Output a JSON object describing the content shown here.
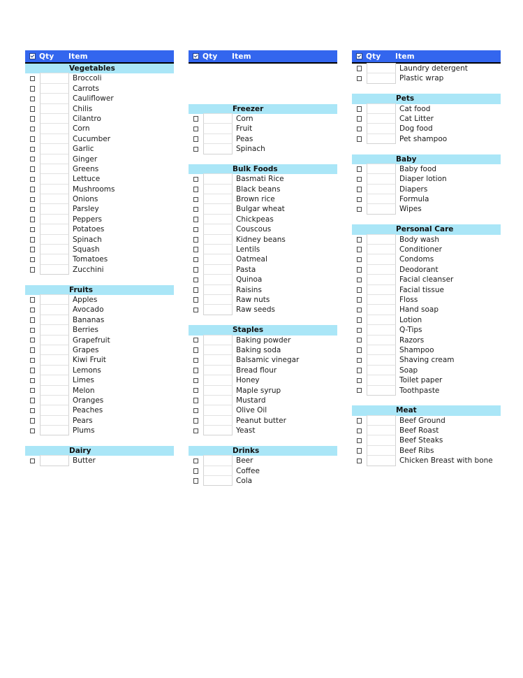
{
  "colors": {
    "header_bar": "#3366ee",
    "header_text": "#ffffff",
    "section_header": "#aae6f7",
    "qty_cell_border": "#d2d2d2",
    "checkbox_border": "#4a4a4a",
    "page_background": "#ffffff"
  },
  "header": {
    "check_icon": "checked-box-icon",
    "qty_label": "Qty",
    "item_label": "Item"
  },
  "columns": [
    {
      "name": "left-column",
      "blocks": [
        {
          "type": "section",
          "title": "Vegetables",
          "items": [
            "Broccoli",
            "Carrots",
            "Cauliflower",
            "Chilis",
            "Cilantro",
            "Corn",
            "Cucumber",
            "Garlic",
            "Ginger",
            "Greens",
            "Lettuce",
            "Mushrooms",
            "Onions",
            "Parsley",
            "Peppers",
            "Potatoes",
            "Spinach",
            "Squash",
            "Tomatoes",
            "Zucchini"
          ]
        },
        {
          "type": "spacer"
        },
        {
          "type": "section",
          "title": "Fruits",
          "items": [
            "Apples",
            "Avocado",
            "Bananas",
            "Berries",
            "Grapefruit",
            "Grapes",
            "Kiwi Fruit",
            "Lemons",
            "Limes",
            "Melon",
            "Oranges",
            "Peaches",
            "Pears",
            "Plums"
          ]
        },
        {
          "type": "spacer"
        },
        {
          "type": "section",
          "title": "Dairy",
          "items": [
            "Butter"
          ]
        }
      ]
    },
    {
      "name": "middle-column",
      "blocks": [
        {
          "type": "spacer"
        },
        {
          "type": "spacer"
        },
        {
          "type": "spacer"
        },
        {
          "type": "spacer"
        },
        {
          "type": "section",
          "title": "Freezer",
          "items": [
            "Corn",
            "Fruit",
            "Peas",
            "Spinach"
          ]
        },
        {
          "type": "spacer"
        },
        {
          "type": "section",
          "title": "Bulk Foods",
          "items": [
            "Basmati Rice",
            "Black beans",
            "Brown rice",
            "Bulgar wheat",
            "Chickpeas",
            "Couscous",
            "Kidney beans",
            "Lentils",
            "Oatmeal",
            "Pasta",
            "Quinoa",
            "Raisins",
            "Raw nuts",
            "Raw seeds"
          ]
        },
        {
          "type": "spacer"
        },
        {
          "type": "section",
          "title": "Staples",
          "items": [
            "Baking powder",
            "Baking soda",
            "Balsamic vinegar",
            "Bread flour",
            "Honey",
            "Maple syrup",
            "Mustard",
            "Olive Oil",
            "Peanut butter",
            "Yeast"
          ]
        },
        {
          "type": "spacer"
        },
        {
          "type": "section",
          "title": "Drinks",
          "items": [
            "Beer",
            "Coffee",
            "Cola"
          ]
        }
      ]
    },
    {
      "name": "right-column",
      "blocks": [
        {
          "type": "plain",
          "items": [
            "Laundry detergent",
            "Plastic wrap"
          ]
        },
        {
          "type": "spacer"
        },
        {
          "type": "section",
          "title": "Pets",
          "items": [
            "Cat food",
            "Cat Litter",
            "Dog food",
            "Pet shampoo"
          ]
        },
        {
          "type": "spacer"
        },
        {
          "type": "section",
          "title": "Baby",
          "items": [
            "Baby food",
            "Diaper lotion",
            "Diapers",
            "Formula",
            "Wipes"
          ]
        },
        {
          "type": "spacer"
        },
        {
          "type": "section",
          "title": "Personal Care",
          "items": [
            "Body wash",
            "Conditioner",
            "Condoms",
            "Deodorant",
            "Facial cleanser",
            "Facial tissue",
            "Floss",
            "Hand soap",
            "Lotion",
            "Q-Tips",
            "Razors",
            "Shampoo",
            "Shaving cream",
            "Soap",
            "Toilet paper",
            "Toothpaste"
          ]
        },
        {
          "type": "spacer"
        },
        {
          "type": "section",
          "title": "Meat",
          "items": [
            "Beef Ground",
            "Beef Roast",
            "Beef Steaks",
            "Beef Ribs",
            "Chicken Breast with bone"
          ]
        }
      ]
    }
  ]
}
